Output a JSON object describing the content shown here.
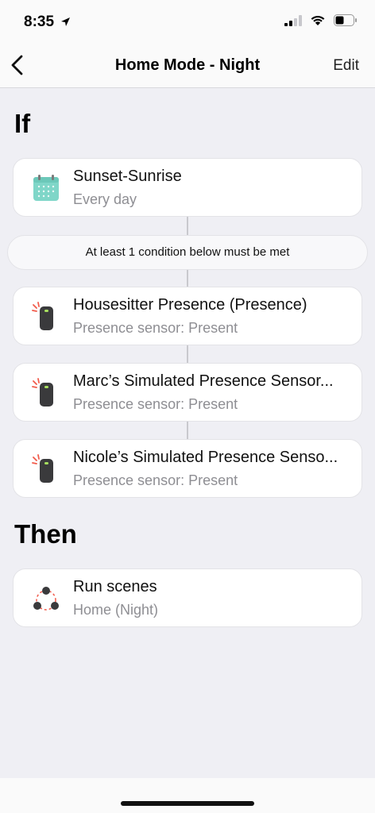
{
  "status_bar": {
    "time": "8:35"
  },
  "nav": {
    "title": "Home Mode - Night",
    "edit_label": "Edit"
  },
  "if_section": {
    "heading": "If",
    "trigger": {
      "title": "Sunset-Sunrise",
      "subtitle": "Every day",
      "icon": "calendar-icon"
    },
    "condition_note": "At least 1 condition below must be met",
    "conditions": [
      {
        "title": "Housesitter Presence (Presence)",
        "subtitle": "Presence sensor: Present",
        "icon": "presence-sensor-icon"
      },
      {
        "title": "Marc’s Simulated Presence Sensor...",
        "subtitle": "Presence sensor: Present",
        "icon": "presence-sensor-icon"
      },
      {
        "title": "Nicole’s Simulated Presence Senso...",
        "subtitle": "Presence sensor: Present",
        "icon": "presence-sensor-icon"
      }
    ]
  },
  "then_section": {
    "heading": "Then",
    "actions": [
      {
        "title": "Run scenes",
        "subtitle": "Home (Night)",
        "icon": "scenes-icon"
      }
    ]
  },
  "colors": {
    "background": "#efeff4",
    "card": "#ffffff",
    "secondary_text": "#8e8e93",
    "calendar_teal": "#7fd6c8",
    "sensor_red": "#f15a4a"
  }
}
